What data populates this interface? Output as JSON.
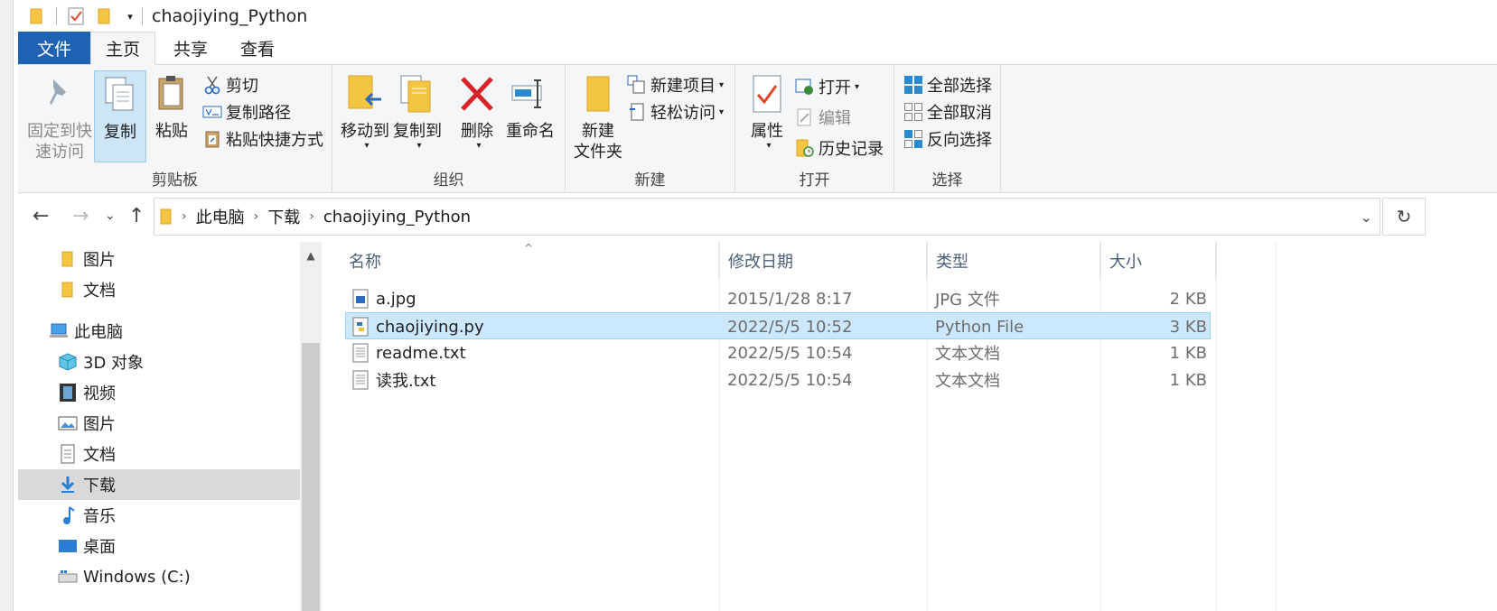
{
  "window": {
    "title": "chaojiying_Python"
  },
  "tabs": [
    {
      "label": "文件"
    },
    {
      "label": "主页"
    },
    {
      "label": "共享"
    },
    {
      "label": "查看"
    }
  ],
  "ribbon": {
    "clipboard": {
      "pin_label_1": "固定到快",
      "pin_label_2": "速访问",
      "copy_label": "复制",
      "paste_label": "粘贴",
      "cut_label": "剪切",
      "copy_path_label": "复制路径",
      "paste_shortcut_label": "粘贴快捷方式",
      "group_label": "剪贴板"
    },
    "organize": {
      "move_to_label": "移动到",
      "copy_to_label": "复制到",
      "delete_label": "删除",
      "rename_label": "重命名",
      "group_label": "组织"
    },
    "new": {
      "new_folder_label_1": "新建",
      "new_folder_label_2": "文件夹",
      "new_item_label": "新建项目",
      "easy_access_label": "轻松访问",
      "group_label": "新建"
    },
    "open": {
      "properties_label": "属性",
      "open_label": "打开",
      "edit_label": "编辑",
      "history_label": "历史记录",
      "group_label": "打开"
    },
    "select": {
      "select_all_label": "全部选择",
      "select_none_label": "全部取消",
      "invert_label": "反向选择",
      "group_label": "选择"
    }
  },
  "address": {
    "crumbs": [
      "此电脑",
      "下载",
      "chaojiying_Python"
    ]
  },
  "navpane": {
    "items": [
      {
        "label": "图片",
        "icon": "folder-icon"
      },
      {
        "label": "文档",
        "icon": "folder-icon"
      },
      {
        "label": "此电脑",
        "icon": "computer-icon"
      },
      {
        "label": "3D 对象",
        "icon": "3d-objects-icon"
      },
      {
        "label": "视频",
        "icon": "video-icon"
      },
      {
        "label": "图片",
        "icon": "pictures-icon"
      },
      {
        "label": "文档",
        "icon": "documents-icon"
      },
      {
        "label": "下载",
        "icon": "download-icon"
      },
      {
        "label": "音乐",
        "icon": "music-icon"
      },
      {
        "label": "桌面",
        "icon": "desktop-icon"
      },
      {
        "label": "Windows (C:)",
        "icon": "drive-icon"
      }
    ]
  },
  "filelist": {
    "columns": [
      "名称",
      "修改日期",
      "类型",
      "大小"
    ],
    "rows": [
      {
        "name": "a.jpg",
        "date": "2015/1/28 8:17",
        "type": "JPG 文件",
        "size": "2 KB",
        "icon": "image-file-icon"
      },
      {
        "name": "chaojiying.py",
        "date": "2022/5/5 10:52",
        "type": "Python File",
        "size": "3 KB",
        "icon": "python-file-icon"
      },
      {
        "name": "readme.txt",
        "date": "2022/5/5 10:54",
        "type": "文本文档",
        "size": "1 KB",
        "icon": "text-file-icon"
      },
      {
        "name": "读我.txt",
        "date": "2022/5/5 10:54",
        "type": "文本文档",
        "size": "1 KB",
        "icon": "text-file-icon"
      }
    ]
  },
  "colors": {
    "file_tab": "#1e62b4",
    "selection": "#cce8ff",
    "folder": "#f4c542"
  }
}
